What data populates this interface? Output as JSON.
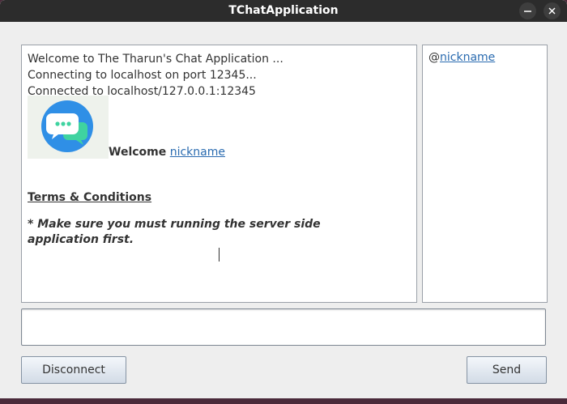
{
  "window": {
    "title": "TChatApplication"
  },
  "chat": {
    "lines": [
      "Welcome to The Tharun's Chat Application ...",
      "Connecting to localhost on port 12345...",
      "Connected to localhost/127.0.0.1:12345"
    ],
    "welcome_label": "Welcome",
    "welcome_nickname": "nickname",
    "terms_heading": "Terms & Conditions",
    "note": "* Make sure you must running the server side application first."
  },
  "users": {
    "prefix": "@",
    "nickname": "nickname"
  },
  "message_input": {
    "value": "",
    "placeholder": ""
  },
  "buttons": {
    "disconnect": "Disconnect",
    "send": "Send"
  },
  "colors": {
    "titlebar": "#2c2c2c",
    "link": "#2a6bb0",
    "logo_blue": "#2f8fe6",
    "logo_green": "#3fd3a0"
  }
}
